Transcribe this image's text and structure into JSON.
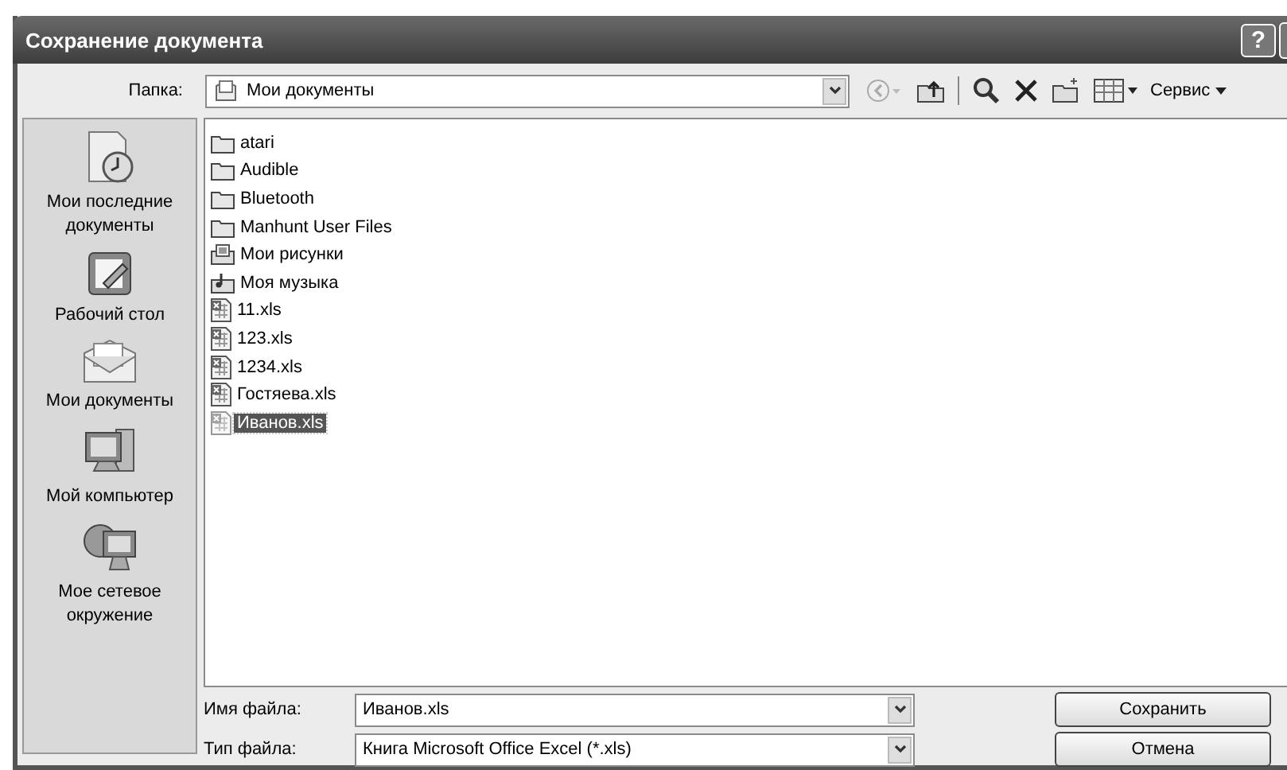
{
  "window": {
    "title": "Сохранение документа",
    "help_button": "?"
  },
  "toolbar": {
    "folder_label": "Папка:",
    "folder": "Мои документы",
    "tools_menu": "Сервис",
    "back_disabled": true
  },
  "sidebar": {
    "items": [
      {
        "kind": "recent",
        "label": "Мои последние документы"
      },
      {
        "kind": "desktop",
        "label": "Рабочий стол"
      },
      {
        "kind": "documents",
        "label": "Мои документы"
      },
      {
        "kind": "computer",
        "label": "Мой компьютер"
      },
      {
        "kind": "network",
        "label": "Мое сетевое окружение"
      }
    ]
  },
  "files": [
    {
      "kind": "folder",
      "name": "atari",
      "selected": false
    },
    {
      "kind": "folder",
      "name": "Audible",
      "selected": false
    },
    {
      "kind": "folder",
      "name": "Bluetooth",
      "selected": false
    },
    {
      "kind": "folder",
      "name": "Manhunt User Files",
      "selected": false
    },
    {
      "kind": "pictures",
      "name": "Мои рисунки",
      "selected": false
    },
    {
      "kind": "music",
      "name": "Моя музыка",
      "selected": false
    },
    {
      "kind": "xls",
      "name": "11.xls",
      "selected": false
    },
    {
      "kind": "xls",
      "name": "123.xls",
      "selected": false
    },
    {
      "kind": "xls",
      "name": "1234.xls",
      "selected": false
    },
    {
      "kind": "xls",
      "name": "Гостяева.xls",
      "selected": false
    },
    {
      "kind": "xls",
      "name": "Иванов.xls",
      "selected": true
    }
  ],
  "filename": {
    "label": "Имя файла:",
    "value": "Иванов.xls"
  },
  "filetype": {
    "label": "Тип файла:",
    "value": "Книга Microsoft Office Excel (*.xls)"
  },
  "buttons": [
    "Сохранить",
    "Отмена"
  ]
}
